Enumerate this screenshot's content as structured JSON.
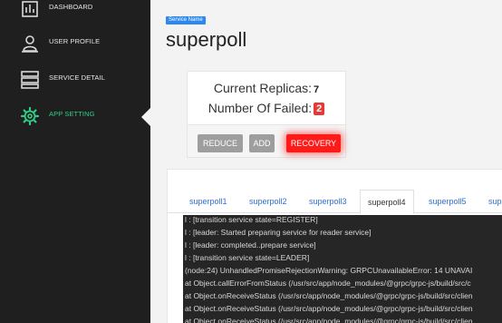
{
  "sidebar": {
    "items": [
      {
        "label": "DASHBOARD",
        "icon": "dashboard-icon"
      },
      {
        "label": "USER PROFILE",
        "icon": "user-icon"
      },
      {
        "label": "SERVICE DETAIL",
        "icon": "list-icon"
      },
      {
        "label": "APP SETTING",
        "icon": "gear-icon"
      }
    ],
    "active_color": "#2fcf8a"
  },
  "header": {
    "badge": "Service Name",
    "title": "superpoll"
  },
  "replicas": {
    "current_label": "Current Replicas:",
    "current_value": "7",
    "failed_label": "Number Of Failed:",
    "failed_value": "2",
    "buttons": {
      "reduce": "REDUCE",
      "add": "ADD",
      "recovery": "RECOVERY"
    }
  },
  "logs": {
    "tabs": [
      "superpoll1",
      "superpoll2",
      "superpoll3",
      "superpoll4",
      "superpoll5",
      "sup"
    ],
    "active_tab": "superpoll4",
    "lines": [
      "l : [transition service state=REGISTER]",
      "l : [leader: Started preparing service for reader service]",
      "l : [leader: completed..prepare service]",
      "l : [transition service state=LEADER]",
      "(node:24) UnhandledPromiseRejectionWarning: GRPCUnavailableError: 14 UNAVAI",
      "at Object.callErrorFromStatus (/usr/src/app/node_modules/@grpc/grpc-js/build/src/c",
      "at Object.onReceiveStatus (/usr/src/app/node_modules/@grpc/grpc-js/build/src/clien",
      "at Object.onReceiveStatus (/usr/src/app/node_modules/@grpc/grpc-js/build/src/clien",
      "at Object.onReceiveStatus (/usr/src/app/node_modules/@grpc/grpc-js/build/src/clien"
    ]
  }
}
